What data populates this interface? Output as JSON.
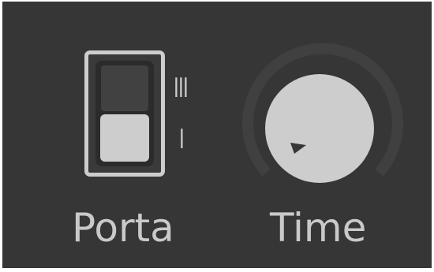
{
  "controls": {
    "porta": {
      "label": "Porta",
      "positions": {
        "upper": "III",
        "lower": "I"
      },
      "selected": "I"
    },
    "time": {
      "label": "Time",
      "level": 0.0
    }
  },
  "colors": {
    "background": "#363636",
    "foreground": "#cdcdcd",
    "track": "#404040"
  }
}
